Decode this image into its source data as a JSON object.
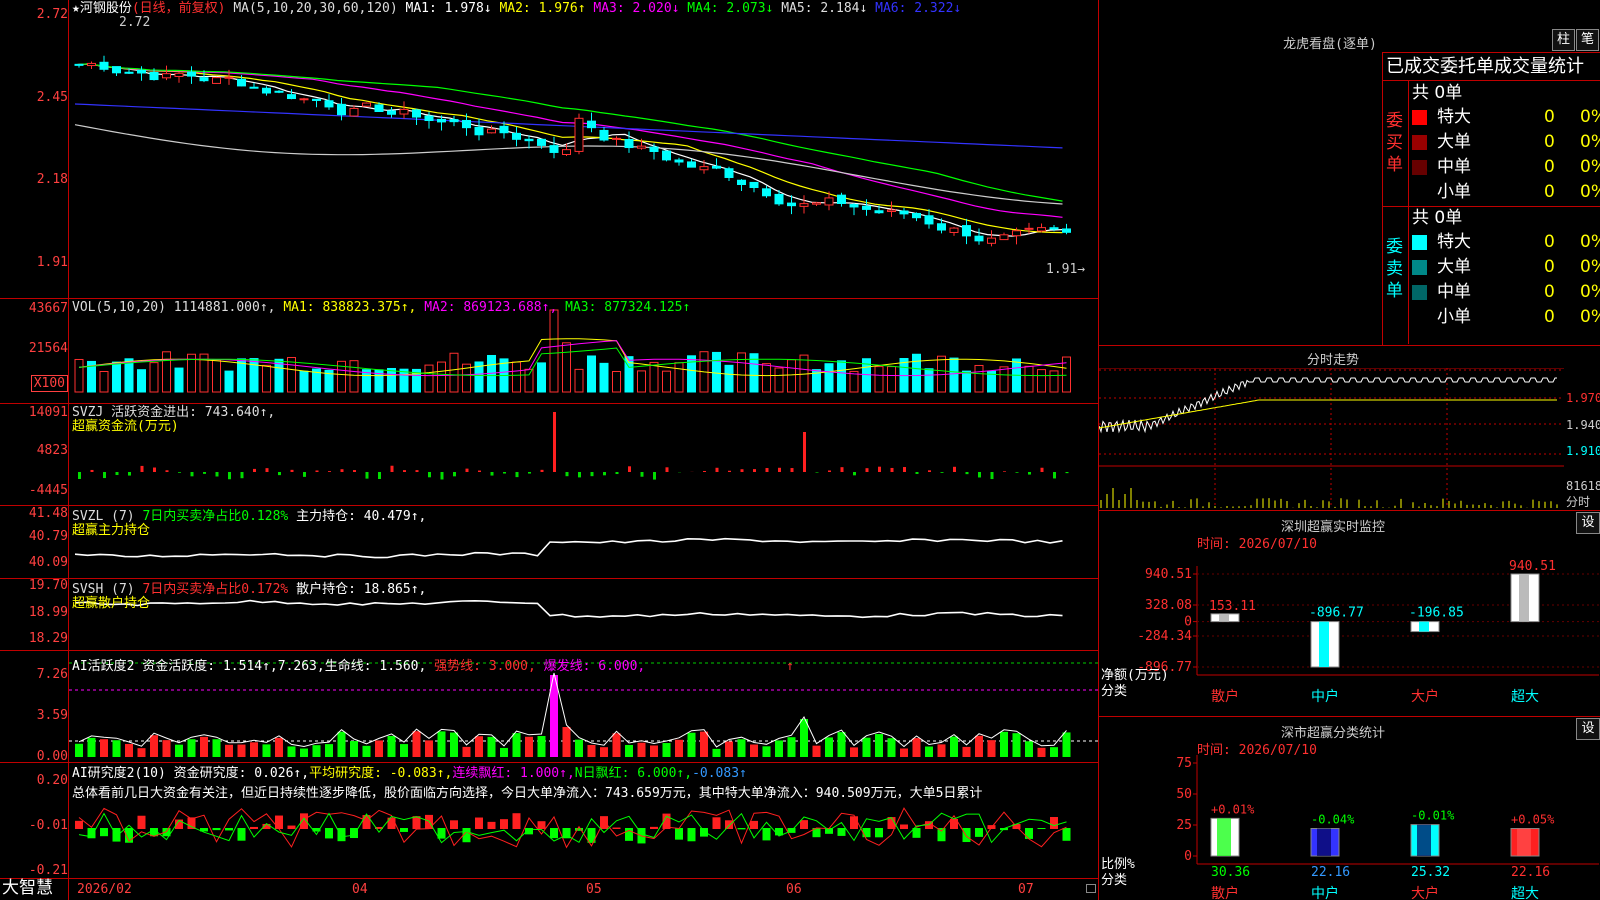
{
  "stock": {
    "star": "★",
    "name": "河钢股份",
    "period": "(日线，前复权)"
  },
  "ma_line": [
    {
      "label": "MA(5,10,20,30,60,120)",
      "color": "#dddddd"
    },
    {
      "label": "MA1: 1.978↓",
      "color": "#ffffff"
    },
    {
      "label": "MA2: 1.976↑",
      "color": "#ffff00"
    },
    {
      "label": "MA3: 2.020↓",
      "color": "#ff00ff"
    },
    {
      "label": "MA4: 2.073↓",
      "color": "#00ff00"
    },
    {
      "label": "MA5: 2.184↓",
      "color": "#dddddd"
    },
    {
      "label": "MA6: 2.322↓",
      "color": "#3333ff"
    }
  ],
  "main_y": [
    "2.72",
    "2.45",
    "2.18",
    "1.91"
  ],
  "hi_mark": "2.72",
  "lo_mark": "1.91→",
  "vol": {
    "head": "VOL(5,10,20) 1114881.000↑,",
    "ma1": "MA1: 838823.375↑,",
    "ma2": "MA2: 869123.688↑,",
    "ma3": "MA3: 877324.125↑",
    "y": [
      "43667",
      "21564"
    ],
    "unit": "X100"
  },
  "svzj": {
    "head": "SVZJ  活跃资金进出: 743.640↑,",
    "sub": "超赢资金流(万元)",
    "y": [
      "14091",
      "4823",
      "-4445"
    ]
  },
  "svzl": {
    "head": "SVZL (7) ",
    "h2": "7日内买卖净占比0.128%",
    "h3": "主力持仓: 40.479↑,",
    "sub": "超赢主力持仓",
    "y": [
      "41.48",
      "40.79",
      "40.09"
    ]
  },
  "svsh": {
    "head": "SVSH (7) ",
    "h2": "7日内买卖净占比0.172%",
    "h3": "散户持仓: 18.865↑,",
    "sub": "超赢散户持仓",
    "y": [
      "19.70",
      "18.99",
      "18.29"
    ]
  },
  "ai1": {
    "head": "AI活跃度2 资金活跃度: 1.514↑,7.263,",
    "h2": "生命线: 1.560,",
    "h3": "强势线: 3.000,",
    "h4": "爆发线: 6.000,",
    "h5": "↑",
    "y": [
      "7.26",
      "3.59",
      "0.00"
    ]
  },
  "ai2": {
    "head": "AI研究度2(10) 资金研究度: 0.026↑,",
    "h2": "平均研究度: -0.083↑,",
    "h3": "连续飘红: 1.000↑,",
    "h4": "N日飘红: 6.000↑,",
    "h5": "-0.083↑",
    "summary": "总体看前几日大资金有关注，但近日持续性逐步降低，股价面临方向选择，今日大单净流入：743.659万元，其中特大单净流入：940.509万元，大单5日累计",
    "y": [
      "0.20",
      "-0.01",
      "-0.21"
    ]
  },
  "xaxis": {
    "brand": "大智慧",
    "labels": [
      "2026/02",
      "04",
      "05",
      "06",
      "07"
    ]
  },
  "dragon": {
    "title": "龙虎看盘(逐单)",
    "btn1": "柱",
    "btn2": "笔",
    "subtitle": "已成交委托单成交量统计",
    "buy_side": "委买单",
    "sell_side": "委卖单",
    "total": "共 0单",
    "buy_rows": [
      {
        "name": "特大",
        "n": "0",
        "p": "0%",
        "color": "#ff0000"
      },
      {
        "name": "大单",
        "n": "0",
        "p": "0%",
        "color": "#990000"
      },
      {
        "name": "中单",
        "n": "0",
        "p": "0%",
        "color": "#660000"
      },
      {
        "name": "小单",
        "n": "0",
        "p": "0%",
        "color": "#000000"
      }
    ],
    "sell_rows": [
      {
        "name": "特大",
        "n": "0",
        "p": "0%",
        "color": "#00ffff"
      },
      {
        "name": "大单",
        "n": "0",
        "p": "0%",
        "color": "#008888"
      },
      {
        "name": "中单",
        "n": "0",
        "p": "0%",
        "color": "#006666"
      },
      {
        "name": "小单",
        "n": "0",
        "p": "0%",
        "color": "#000000"
      }
    ]
  },
  "intraday": {
    "title": "分时走势",
    "y": [
      "1.970",
      "1.940",
      "1.910"
    ],
    "vol": "81618",
    "vol2": "分时"
  },
  "monitor": {
    "title": "深圳超赢实时监控",
    "btn": "设",
    "date": "时间: 2026/07/10",
    "y": [
      "940.51",
      "328.08",
      "0",
      "-284.34",
      "-896.77"
    ],
    "ylabel": "净额(万元)",
    "xlabel": "分类",
    "bars": [
      {
        "cat": "散户",
        "value": 153.11,
        "label": "153.11"
      },
      {
        "cat": "中户",
        "value": -896.77,
        "label": "-896.77"
      },
      {
        "cat": "大户",
        "value": -196.85,
        "label": "-196.85"
      },
      {
        "cat": "超大",
        "value": 940.51,
        "label": "940.51"
      }
    ]
  },
  "classify": {
    "title": "深市超赢分类统计",
    "btn": "设",
    "date": "时间: 2026/07/10",
    "y": [
      "75",
      "50",
      "25",
      "0"
    ],
    "ylabel": "比例%",
    "xlabel": "分类",
    "bars": [
      {
        "cat": "散户",
        "value": 30.36,
        "label": "30.36",
        "chg": "+0.01%"
      },
      {
        "cat": "中户",
        "value": 22.16,
        "label": "22.16",
        "chg": "-0.04%"
      },
      {
        "cat": "大户",
        "value": 25.32,
        "label": "25.32",
        "chg": "-0.01%"
      },
      {
        "cat": "超大",
        "value": 22.16,
        "label": "22.16",
        "chg": "+0.05%"
      }
    ]
  },
  "chart_data": [
    {
      "type": "bar",
      "title": "深圳超赢实时监控",
      "categories": [
        "散户",
        "中户",
        "大户",
        "超大"
      ],
      "values": [
        153.11,
        -896.77,
        -196.85,
        940.51
      ],
      "ylabel": "净额(万元)",
      "xlabel": "分类",
      "ylim": [
        -896.77,
        940.51
      ]
    },
    {
      "type": "bar",
      "title": "深市超赢分类统计",
      "categories": [
        "散户",
        "中户",
        "大户",
        "超大"
      ],
      "values": [
        30.36,
        22.16,
        25.32,
        22.16
      ],
      "ylabel": "比例%",
      "xlabel": "分类",
      "ylim": [
        0,
        75
      ]
    },
    {
      "type": "line",
      "title": "河钢股份 (日线，前复权)",
      "series": [
        {
          "name": "MA1",
          "values": [
            1.978
          ]
        },
        {
          "name": "MA2",
          "values": [
            1.976
          ]
        },
        {
          "name": "MA3",
          "values": [
            2.02
          ]
        },
        {
          "name": "MA4",
          "values": [
            2.073
          ]
        },
        {
          "name": "MA5",
          "values": [
            2.184
          ]
        },
        {
          "name": "MA6",
          "values": [
            2.322
          ]
        }
      ],
      "ylim": [
        1.91,
        2.72
      ]
    }
  ]
}
